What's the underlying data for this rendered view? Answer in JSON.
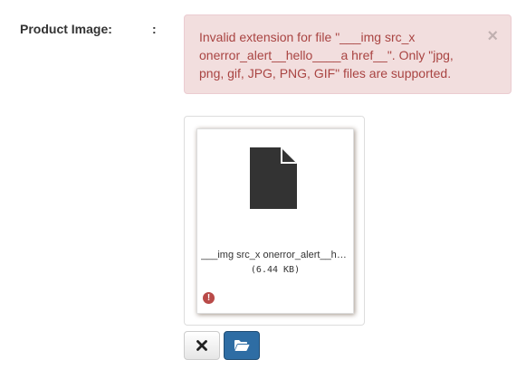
{
  "form": {
    "label": "Product Image:",
    "colon": ":"
  },
  "alert": {
    "message": "Invalid extension for file \"___img src_x onerror_alert__hello____a href__\". Only \"jpg, png, gif, JPG, PNG, GIF\" files are supported.",
    "close_glyph": "×"
  },
  "preview": {
    "file_name": "___img src_x onerror_alert__hello____a href__",
    "file_size": "(6.44 KB)",
    "file_icon": "file-icon",
    "status_icon": "error-icon",
    "status_glyph": "!"
  },
  "actions": {
    "remove_icon": "remove-icon",
    "browse_icon": "folder-open-icon"
  },
  "colors": {
    "alert_bg": "#f2dede",
    "alert_text": "#a94442",
    "primary": "#2e6da4",
    "error": "#b94a48"
  }
}
